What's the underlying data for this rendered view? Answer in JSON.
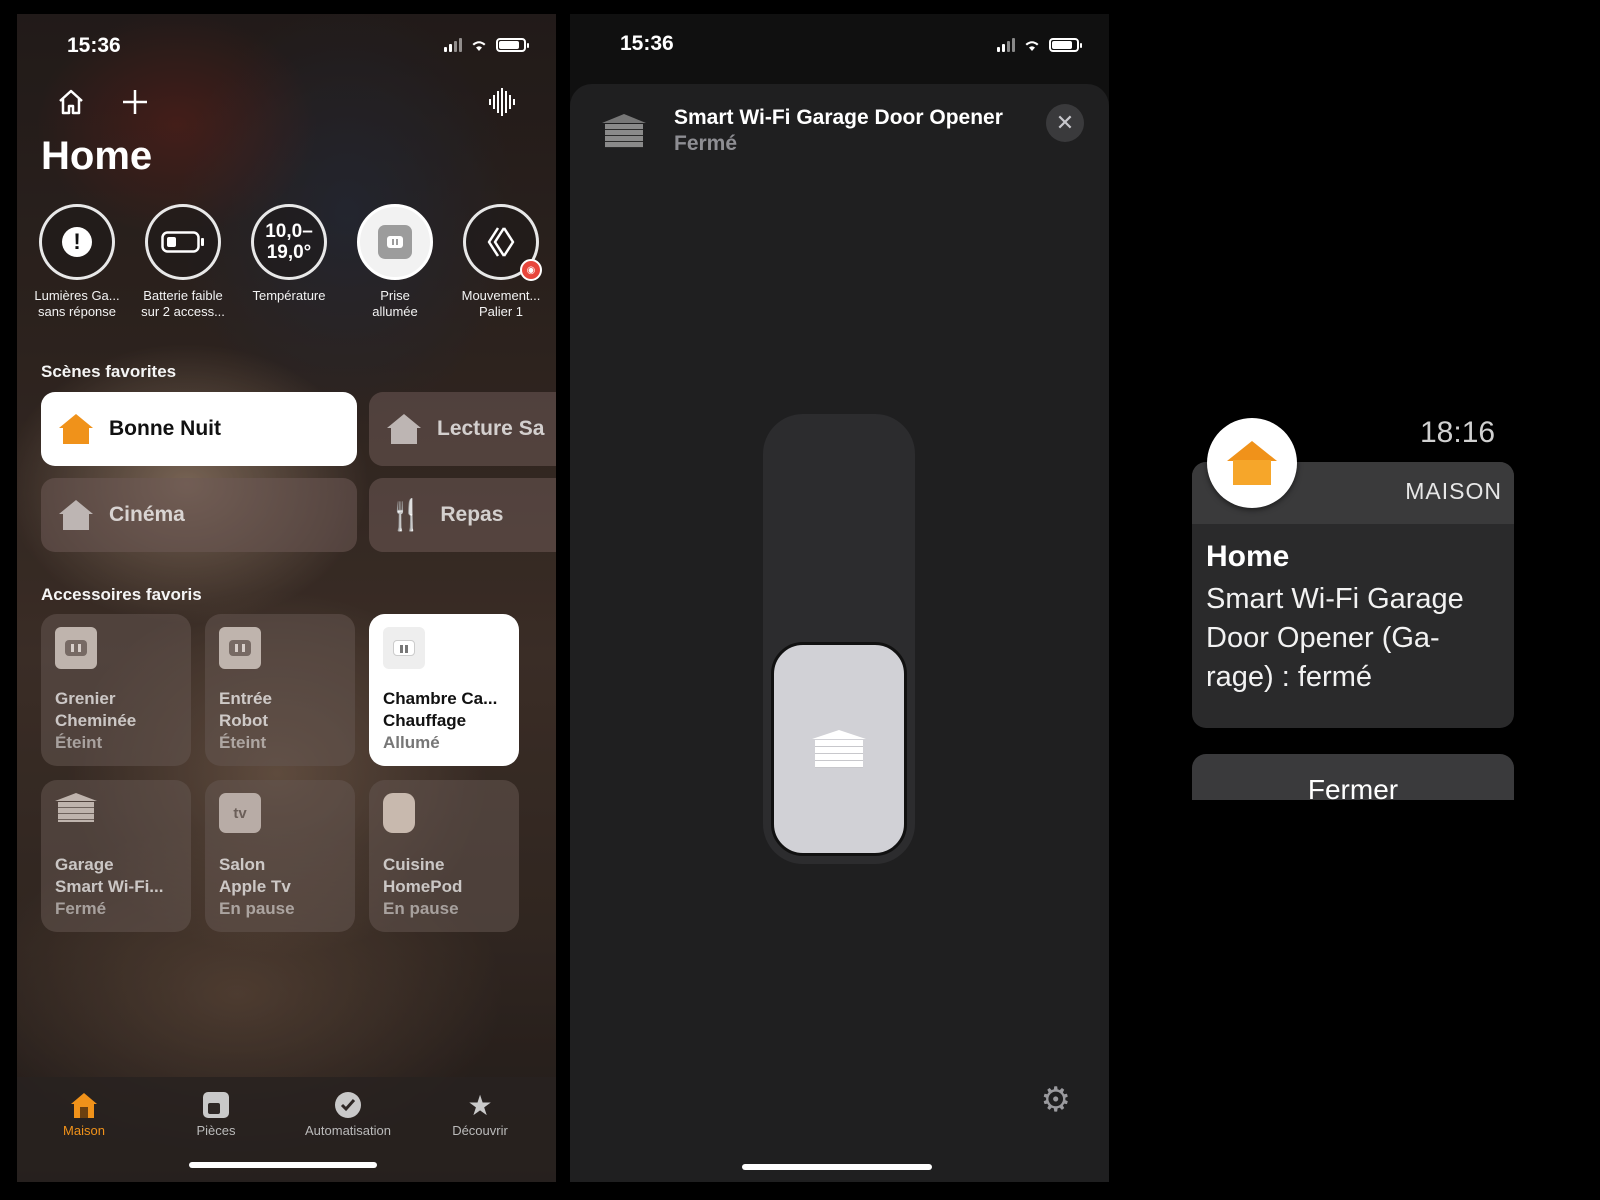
{
  "home_screen": {
    "status_time": "15:36",
    "title": "Home",
    "status_items": [
      {
        "label_line1": "Lumières Ga...",
        "label_line2": "sans réponse",
        "icon": "warning-icon"
      },
      {
        "label_line1": "Batterie faible",
        "label_line2": "sur 2 access...",
        "icon": "battery-low-icon"
      },
      {
        "value_line1": "10,0–",
        "value_line2": "19,0°",
        "label_line1": "Température",
        "icon": "thermometer"
      },
      {
        "label_line1": "Prise",
        "label_line2": "allumée",
        "icon": "outlet-icon"
      },
      {
        "label_line1": "Mouvement...",
        "label_line2": "Palier 1",
        "icon": "motion-sensor-icon"
      }
    ],
    "scenes_header": "Scènes favorites",
    "scenes": [
      {
        "label": "Bonne Nuit",
        "icon": "house-icon",
        "active": true
      },
      {
        "label": "Lecture Sa",
        "icon": "house-icon",
        "active": false
      },
      {
        "label": "Cinéma",
        "icon": "house-icon",
        "active": false
      },
      {
        "label": "Repas",
        "icon": "cutlery-icon",
        "active": false
      }
    ],
    "accessories_header": "Accessoires favoris",
    "accessories": [
      {
        "room": "Grenier",
        "name": "Cheminée",
        "state": "Éteint",
        "icon": "outlet-icon",
        "on": false
      },
      {
        "room": "Entrée",
        "name": "Robot",
        "state": "Éteint",
        "icon": "outlet-icon",
        "on": false
      },
      {
        "room": "Chambre Ca...",
        "name": "Chauffage",
        "state": "Allumé",
        "icon": "outlet-icon",
        "on": true
      },
      {
        "room": "Garage",
        "name": "Smart Wi-Fi...",
        "state": "Fermé",
        "icon": "garage-door-icon",
        "on": false
      },
      {
        "room": "Salon",
        "name": "Apple Tv",
        "state": "En pause",
        "icon": "appletv-icon",
        "on": false
      },
      {
        "room": "Cuisine",
        "name": "HomePod",
        "state": "En pause",
        "icon": "homepod-icon",
        "on": false
      }
    ],
    "tv_icon_text": "tv",
    "tabs": [
      {
        "label": "Maison",
        "icon": "house-icon",
        "selected": true
      },
      {
        "label": "Pièces",
        "icon": "rooms-icon",
        "selected": false
      },
      {
        "label": "Automatisation",
        "icon": "clock-check-icon",
        "selected": false
      },
      {
        "label": "Découvrir",
        "icon": "star-icon",
        "selected": false
      }
    ]
  },
  "garage_screen": {
    "status_time": "15:36",
    "title": "Smart Wi-Fi Garage Door Opener",
    "state": "Fermé",
    "position_percent": 0
  },
  "watch": {
    "time": "18:16",
    "app_name": "MAISON",
    "notif_title": "Home",
    "notif_body": "Smart Wi-Fi Garage Door Opener (Ga-rage) : fermé",
    "button_label": "Fermer"
  },
  "colors": {
    "accent": "#f0921a",
    "tile_on": "#ffffff",
    "sheet_bg": "#1f1f20"
  }
}
